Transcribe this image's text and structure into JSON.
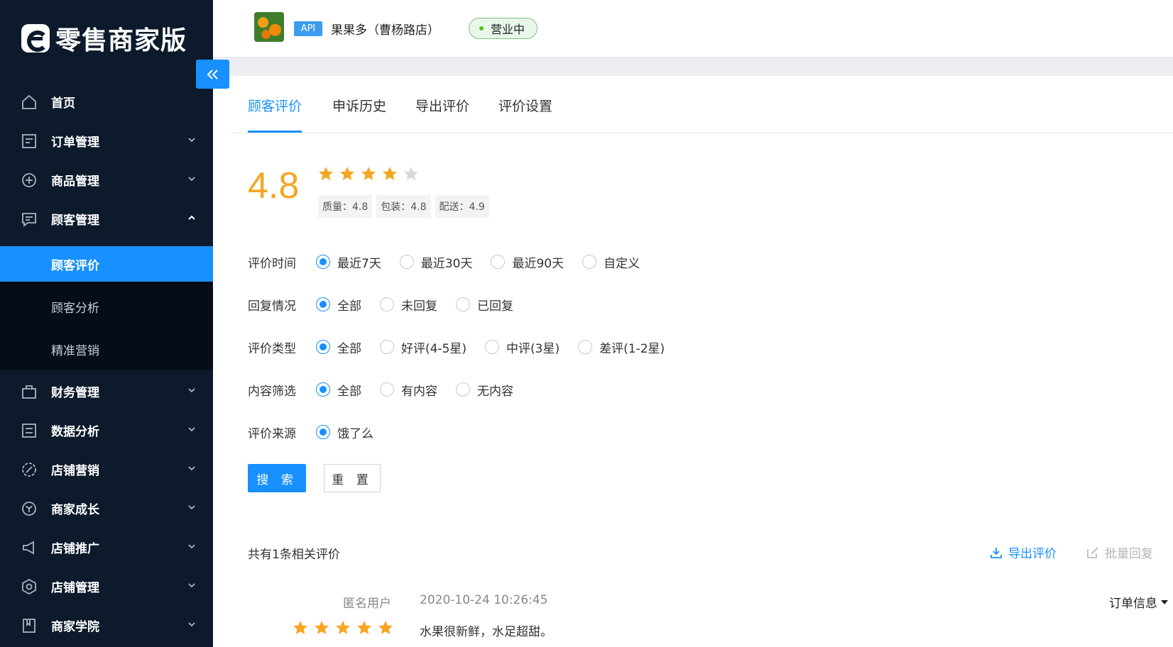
{
  "brand": {
    "title": "零售商家版"
  },
  "sidebar": {
    "items": [
      {
        "label": "首页",
        "icon": "home-icon"
      },
      {
        "label": "订单管理",
        "icon": "order-icon"
      },
      {
        "label": "商品管理",
        "icon": "product-icon"
      },
      {
        "label": "顾客管理",
        "icon": "customer-icon"
      },
      {
        "label": "财务管理",
        "icon": "finance-icon"
      },
      {
        "label": "数据分析",
        "icon": "data-icon"
      },
      {
        "label": "店铺营销",
        "icon": "marketing-icon"
      },
      {
        "label": "商家成长",
        "icon": "growth-icon"
      },
      {
        "label": "店铺推广",
        "icon": "promotion-icon"
      },
      {
        "label": "店铺管理",
        "icon": "settings-icon"
      },
      {
        "label": "商家学院",
        "icon": "academy-icon"
      }
    ],
    "sub_items": [
      {
        "label": "顾客评价"
      },
      {
        "label": "顾客分析"
      },
      {
        "label": "精准营销"
      }
    ]
  },
  "header": {
    "api_badge": "API",
    "shop_name": "果果多（曹杨路店）",
    "status": "营业中"
  },
  "tabs": [
    "顾客评价",
    "申诉历史",
    "导出评价",
    "评价设置"
  ],
  "rating": {
    "score": "4.8",
    "stars": 4,
    "max_stars": 5,
    "sub_scores": [
      "质量：4.8",
      "包装：4.8",
      "配送：4.9"
    ]
  },
  "filters": [
    {
      "label": "评价时间",
      "options": [
        "最近7天",
        "最近30天",
        "最近90天",
        "自定义"
      ],
      "selected": 0
    },
    {
      "label": "回复情况",
      "options": [
        "全部",
        "未回复",
        "已回复"
      ],
      "selected": 0
    },
    {
      "label": "评价类型",
      "options": [
        "全部",
        "好评(4-5星)",
        "中评(3星)",
        "差评(1-2星)"
      ],
      "selected": 0
    },
    {
      "label": "内容筛选",
      "options": [
        "全部",
        "有内容",
        "无内容"
      ],
      "selected": 0
    },
    {
      "label": "评价来源",
      "options": [
        "饿了么"
      ],
      "selected": 0
    }
  ],
  "actions": {
    "search": "搜 索",
    "reset": "重 置"
  },
  "results": {
    "count_text": "共有1条相关评价",
    "export": "导出评价",
    "batch_reply": "批量回复"
  },
  "review": {
    "user": "匿名用户",
    "time": "2020-10-24 10:26:45",
    "stars": 5,
    "content": "水果很新鲜，水足超甜。",
    "order_info": "订单信息"
  },
  "colors": {
    "accent": "#1890ff",
    "star": "#f5a623",
    "sidebar": "#0c1a2b"
  }
}
